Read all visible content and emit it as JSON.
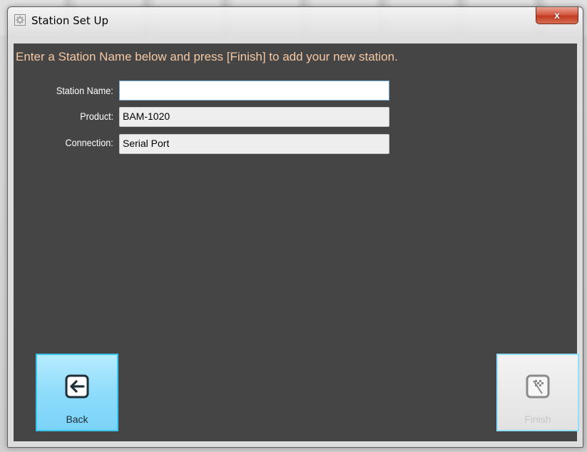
{
  "window": {
    "title": "Station Set Up",
    "close_label": "x"
  },
  "content": {
    "instruction": "Enter a Station Name below and press [Finish] to add your new station."
  },
  "form": {
    "station_name": {
      "label": "Station Name:",
      "value": ""
    },
    "product": {
      "label": "Product:",
      "value": "BAM-1020"
    },
    "connection": {
      "label": "Connection:",
      "value": "Serial Port"
    }
  },
  "buttons": {
    "back_label": "Back",
    "finish_label": "Finish",
    "finish_enabled": false
  },
  "icons": {
    "title": "gear-icon",
    "back": "arrow-left-icon",
    "finish": "checkered-flag-icon"
  },
  "colors": {
    "panel_background": "#454545",
    "instruction_text": "#f5c8a4",
    "back_button": "#8fdcfb",
    "accent_border": "#39c5f0",
    "close_button": "#c23b22"
  }
}
